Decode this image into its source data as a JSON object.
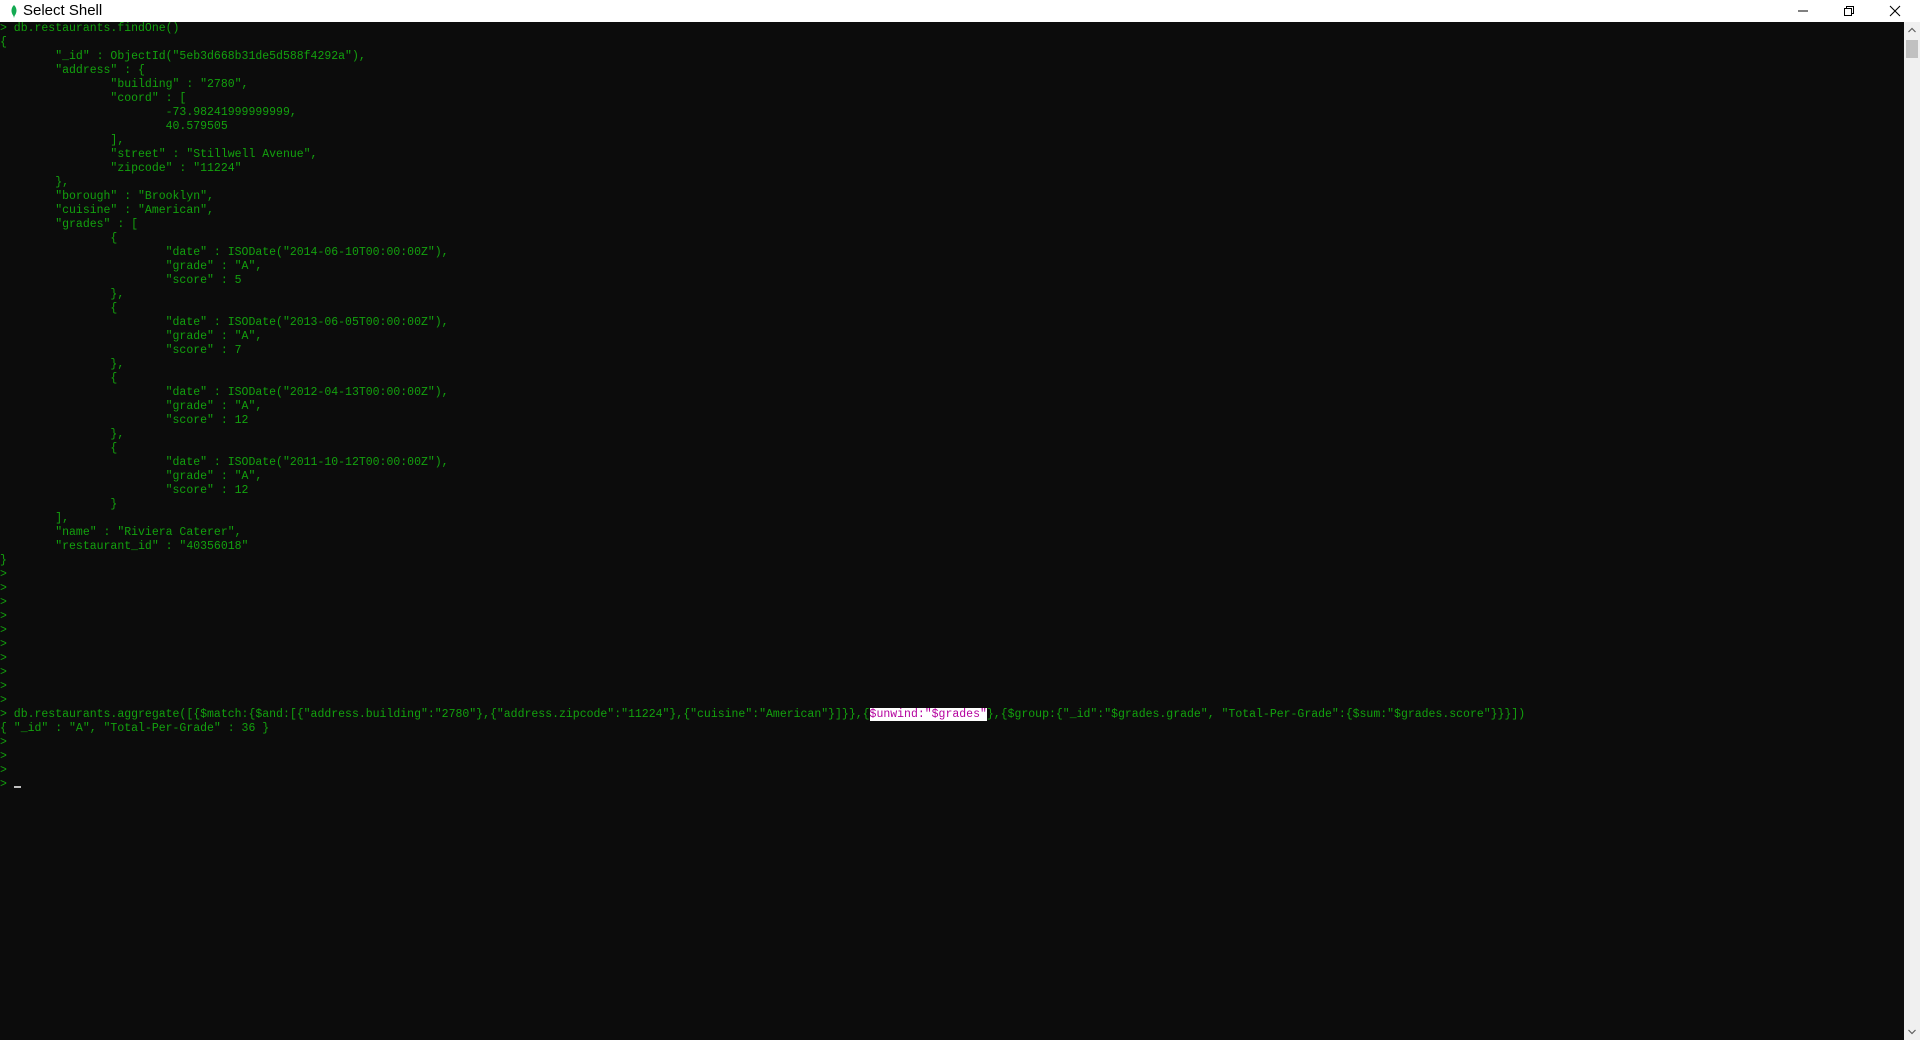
{
  "window": {
    "title": "Select Shell",
    "icon": "mongodb-leaf-icon",
    "controls": [
      "minimize-icon",
      "restore-icon",
      "close-icon"
    ]
  },
  "colors": {
    "console_background": "#0c0c0c",
    "console_text": "#13a10e",
    "selection_background": "#ffffff",
    "selection_text": "#b4009e"
  },
  "console": {
    "lines": [
      "> db.restaurants.findOne()",
      "{",
      "        \"_id\" : ObjectId(\"5eb3d668b31de5d588f4292a\"),",
      "        \"address\" : {",
      "                \"building\" : \"2780\",",
      "                \"coord\" : [",
      "                        -73.98241999999999,",
      "                        40.579505",
      "                ],",
      "                \"street\" : \"Stillwell Avenue\",",
      "                \"zipcode\" : \"11224\"",
      "        },",
      "        \"borough\" : \"Brooklyn\",",
      "        \"cuisine\" : \"American\",",
      "        \"grades\" : [",
      "                {",
      "                        \"date\" : ISODate(\"2014-06-10T00:00:00Z\"),",
      "                        \"grade\" : \"A\",",
      "                        \"score\" : 5",
      "                },",
      "                {",
      "                        \"date\" : ISODate(\"2013-06-05T00:00:00Z\"),",
      "                        \"grade\" : \"A\",",
      "                        \"score\" : 7",
      "                },",
      "                {",
      "                        \"date\" : ISODate(\"2012-04-13T00:00:00Z\"),",
      "                        \"grade\" : \"A\",",
      "                        \"score\" : 12",
      "                },",
      "                {",
      "                        \"date\" : ISODate(\"2011-10-12T00:00:00Z\"),",
      "                        \"grade\" : \"A\",",
      "                        \"score\" : 12",
      "                }",
      "        ],",
      "        \"name\" : \"Riviera Caterer\",",
      "        \"restaurant_id\" : \"40356018\"",
      "}",
      ">",
      ">",
      ">",
      ">",
      ">",
      ">",
      ">",
      ">",
      ">",
      ">"
    ],
    "aggregate_command": {
      "before": "> db.restaurants.aggregate([{$match:{$and:[{\"address.building\":\"2780\"},{\"address.zipcode\":\"11224\"},{\"cuisine\":\"American\"}]}},{",
      "selected": "$unwind:\"$grades\"",
      "after": "},{$group:{\"_id\":\"$grades.grade\", \"Total-Per-Grade\":{$sum:\"$grades.score\"}}}])"
    },
    "result_line": "{ \"_id\" : \"A\", \"Total-Per-Grade\" : 36 }",
    "trailing_prompts": [
      ">",
      ">",
      ">"
    ],
    "final_prompt": "> "
  }
}
